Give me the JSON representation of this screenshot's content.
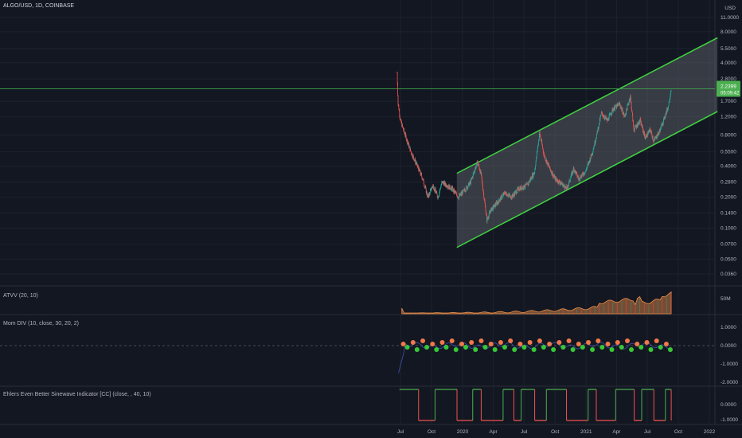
{
  "header": {
    "symbol": "ALGO/USD, 1D, COINBASE"
  },
  "colors": {
    "background": "#131722",
    "grid": "#1e222d",
    "channel_line": "#3fd63f",
    "channel_fill": "#7a7d85",
    "up_candle": "#26a69a",
    "down_candle": "#ef5350",
    "price_line": "#3fa34d",
    "price_badge": "#4caf50",
    "volume_area": "#f0914a",
    "dot_orange": "#f0784a",
    "dot_green": "#37c837",
    "sinewave_green": "#4caf50",
    "sinewave_red": "#ef5350"
  },
  "price_axis": {
    "currency": "USD",
    "ticks": [
      "11.0000",
      "8.0000",
      "5.5000",
      "4.0000",
      "2.8000",
      "1.7000",
      "1.2000",
      "0.8000",
      "0.5500",
      "0.4000",
      "0.2800",
      "0.2000",
      "0.1400",
      "0.1000",
      "0.0700",
      "0.0500",
      "0.0360"
    ],
    "current_price": "2.2399",
    "countdown": "05:09:42",
    "scale": "log"
  },
  "time_axis": {
    "ticks": [
      "Jul",
      "Oct",
      "2020",
      "Apr",
      "Jul",
      "Oct",
      "2021",
      "Apr",
      "Jul",
      "Oct",
      "2022"
    ]
  },
  "panes": {
    "volume": {
      "label": "ATVV (20, 10)",
      "axis_label": "50M"
    },
    "momentum": {
      "label": "Mom DIV (10, close, 30, 20, 2)",
      "ticks": [
        "1.0000",
        "0.0000",
        "-1.0000",
        "-2.0000"
      ]
    },
    "sinewave": {
      "label": "Ehlers Even Better Sinewave Indicator [CC] (close, , 40, 10)",
      "ticks": [
        "0.0000",
        "-1.0000"
      ]
    }
  },
  "chart_data": {
    "type": "candlestick",
    "title": "ALGO/USD, 1D, COINBASE",
    "y_scale": "log",
    "ylim": [
      0.03,
      11.5
    ],
    "x_range": [
      "2019-05-01",
      "2022-02-15"
    ],
    "price_path": [
      [
        "2019-06-21",
        3.2
      ],
      [
        "2019-06-24",
        1.6
      ],
      [
        "2019-07-01",
        1.1
      ],
      [
        "2019-07-15",
        0.8
      ],
      [
        "2019-08-01",
        0.55
      ],
      [
        "2019-08-20",
        0.4
      ],
      [
        "2019-09-05",
        0.3
      ],
      [
        "2019-09-20",
        0.2
      ],
      [
        "2019-10-05",
        0.26
      ],
      [
        "2019-10-20",
        0.2
      ],
      [
        "2019-11-01",
        0.28
      ],
      [
        "2019-11-15",
        0.26
      ],
      [
        "2019-12-01",
        0.24
      ],
      [
        "2019-12-20",
        0.2
      ],
      [
        "2020-01-10",
        0.24
      ],
      [
        "2020-01-25",
        0.28
      ],
      [
        "2020-02-14",
        0.44
      ],
      [
        "2020-02-25",
        0.33
      ],
      [
        "2020-03-13",
        0.12
      ],
      [
        "2020-03-25",
        0.15
      ],
      [
        "2020-04-15",
        0.18
      ],
      [
        "2020-05-05",
        0.22
      ],
      [
        "2020-05-25",
        0.2
      ],
      [
        "2020-06-15",
        0.24
      ],
      [
        "2020-07-10",
        0.26
      ],
      [
        "2020-08-01",
        0.35
      ],
      [
        "2020-08-16",
        0.84
      ],
      [
        "2020-08-30",
        0.5
      ],
      [
        "2020-09-15",
        0.38
      ],
      [
        "2020-10-01",
        0.3
      ],
      [
        "2020-10-20",
        0.27
      ],
      [
        "2020-11-05",
        0.24
      ],
      [
        "2020-11-25",
        0.38
      ],
      [
        "2020-12-10",
        0.3
      ],
      [
        "2020-12-31",
        0.36
      ],
      [
        "2021-01-20",
        0.55
      ],
      [
        "2021-02-01",
        0.8
      ],
      [
        "2021-02-15",
        1.3
      ],
      [
        "2021-03-05",
        1.1
      ],
      [
        "2021-03-20",
        1.4
      ],
      [
        "2021-04-10",
        1.6
      ],
      [
        "2021-04-25",
        1.2
      ],
      [
        "2021-05-12",
        1.9
      ],
      [
        "2021-05-22",
        0.9
      ],
      [
        "2021-06-10",
        1.1
      ],
      [
        "2021-06-25",
        0.75
      ],
      [
        "2021-07-10",
        0.9
      ],
      [
        "2021-07-20",
        0.7
      ],
      [
        "2021-08-05",
        0.85
      ],
      [
        "2021-08-20",
        1.15
      ],
      [
        "2021-09-01",
        1.5
      ],
      [
        "2021-09-10",
        2.24
      ]
    ],
    "channel": {
      "upper": [
        [
          "2019-12-15",
          0.34
        ],
        [
          "2022-01-25",
          7.0
        ]
      ],
      "lower": [
        [
          "2019-12-15",
          0.065
        ],
        [
          "2022-01-25",
          1.35
        ]
      ]
    },
    "horizontal_line": 2.2399
  }
}
